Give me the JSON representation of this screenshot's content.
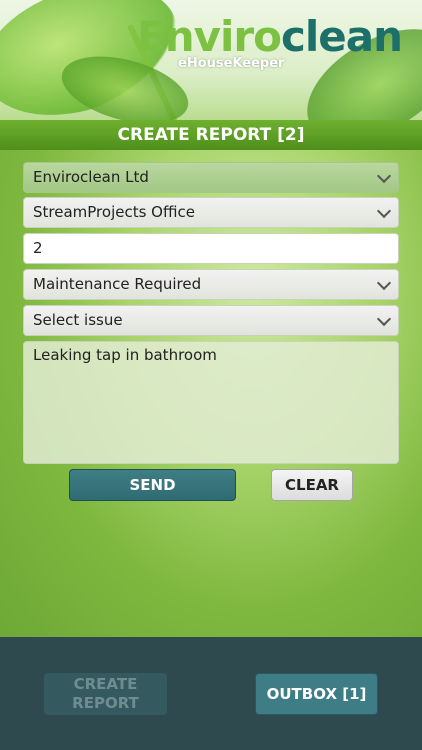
{
  "brand": {
    "logo_part1": "Enviro",
    "logo_part2": "clean",
    "tagline": "eHouseKeeper"
  },
  "header": {
    "title": "CREATE REPORT [2]"
  },
  "form": {
    "company": {
      "value": "Enviroclean Ltd"
    },
    "location": {
      "value": "StreamProjects Office"
    },
    "room": {
      "value": "2"
    },
    "report_type": {
      "value": "Maintenance Required"
    },
    "issue": {
      "value": "Select issue"
    },
    "notes": {
      "value": "Leaking tap in bathroom"
    },
    "send_label": "SEND",
    "clear_label": "CLEAR"
  },
  "footer": {
    "create_report_label_line1": "CREATE",
    "create_report_label_line2": "REPORT",
    "outbox_label": "OUTBOX [1]"
  },
  "colors": {
    "title_bar": "#5b9e24",
    "send_button": "#356f77",
    "footer_bg": "#2f4a4e",
    "logo_green": "#7dc142",
    "logo_teal": "#1d6f6a"
  }
}
